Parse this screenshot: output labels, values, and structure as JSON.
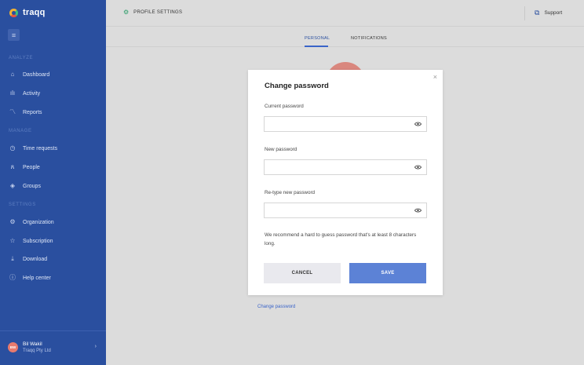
{
  "app": {
    "logo_text": "traqq"
  },
  "sidebar": {
    "sections": {
      "analyze": "ANALYZE",
      "manage": "MANAGE",
      "settings": "SETTINGS"
    },
    "items": [
      {
        "label": "Dashboard",
        "icon": "home-icon"
      },
      {
        "label": "Activity",
        "icon": "bar-chart-icon"
      },
      {
        "label": "Reports",
        "icon": "trend-icon"
      },
      {
        "label": "Time requests",
        "icon": "clock-icon"
      },
      {
        "label": "People",
        "icon": "people-icon"
      },
      {
        "label": "Groups",
        "icon": "layers-icon"
      },
      {
        "label": "Organization",
        "icon": "gear-icon"
      },
      {
        "label": "Subscription",
        "icon": "star-icon"
      },
      {
        "label": "Download",
        "icon": "download-icon"
      },
      {
        "label": "Help center",
        "icon": "help-icon"
      }
    ],
    "user": {
      "initials": "BW",
      "name": "Bil Wakil",
      "org": "Traqq Pty Ltd"
    }
  },
  "header": {
    "title": "PROFILE SETTINGS",
    "support_label": "Support"
  },
  "tabs": [
    {
      "label": "PERSONAL",
      "active": true
    },
    {
      "label": "NOTIFICATIONS",
      "active": false
    }
  ],
  "page": {
    "change_password_link": "Change password"
  },
  "modal": {
    "title": "Change password",
    "fields": [
      {
        "label": "Current password",
        "value": ""
      },
      {
        "label": "New password",
        "value": ""
      },
      {
        "label": "Re-type new password",
        "value": ""
      }
    ],
    "hint": "We recommend a hard to guess password that's at least 8 characters long.",
    "cancel_label": "CANCEL",
    "save_label": "SAVE"
  },
  "colors": {
    "sidebar": "#2a4f9f",
    "accent": "#3a64c8",
    "save_button": "#5c82d6"
  }
}
